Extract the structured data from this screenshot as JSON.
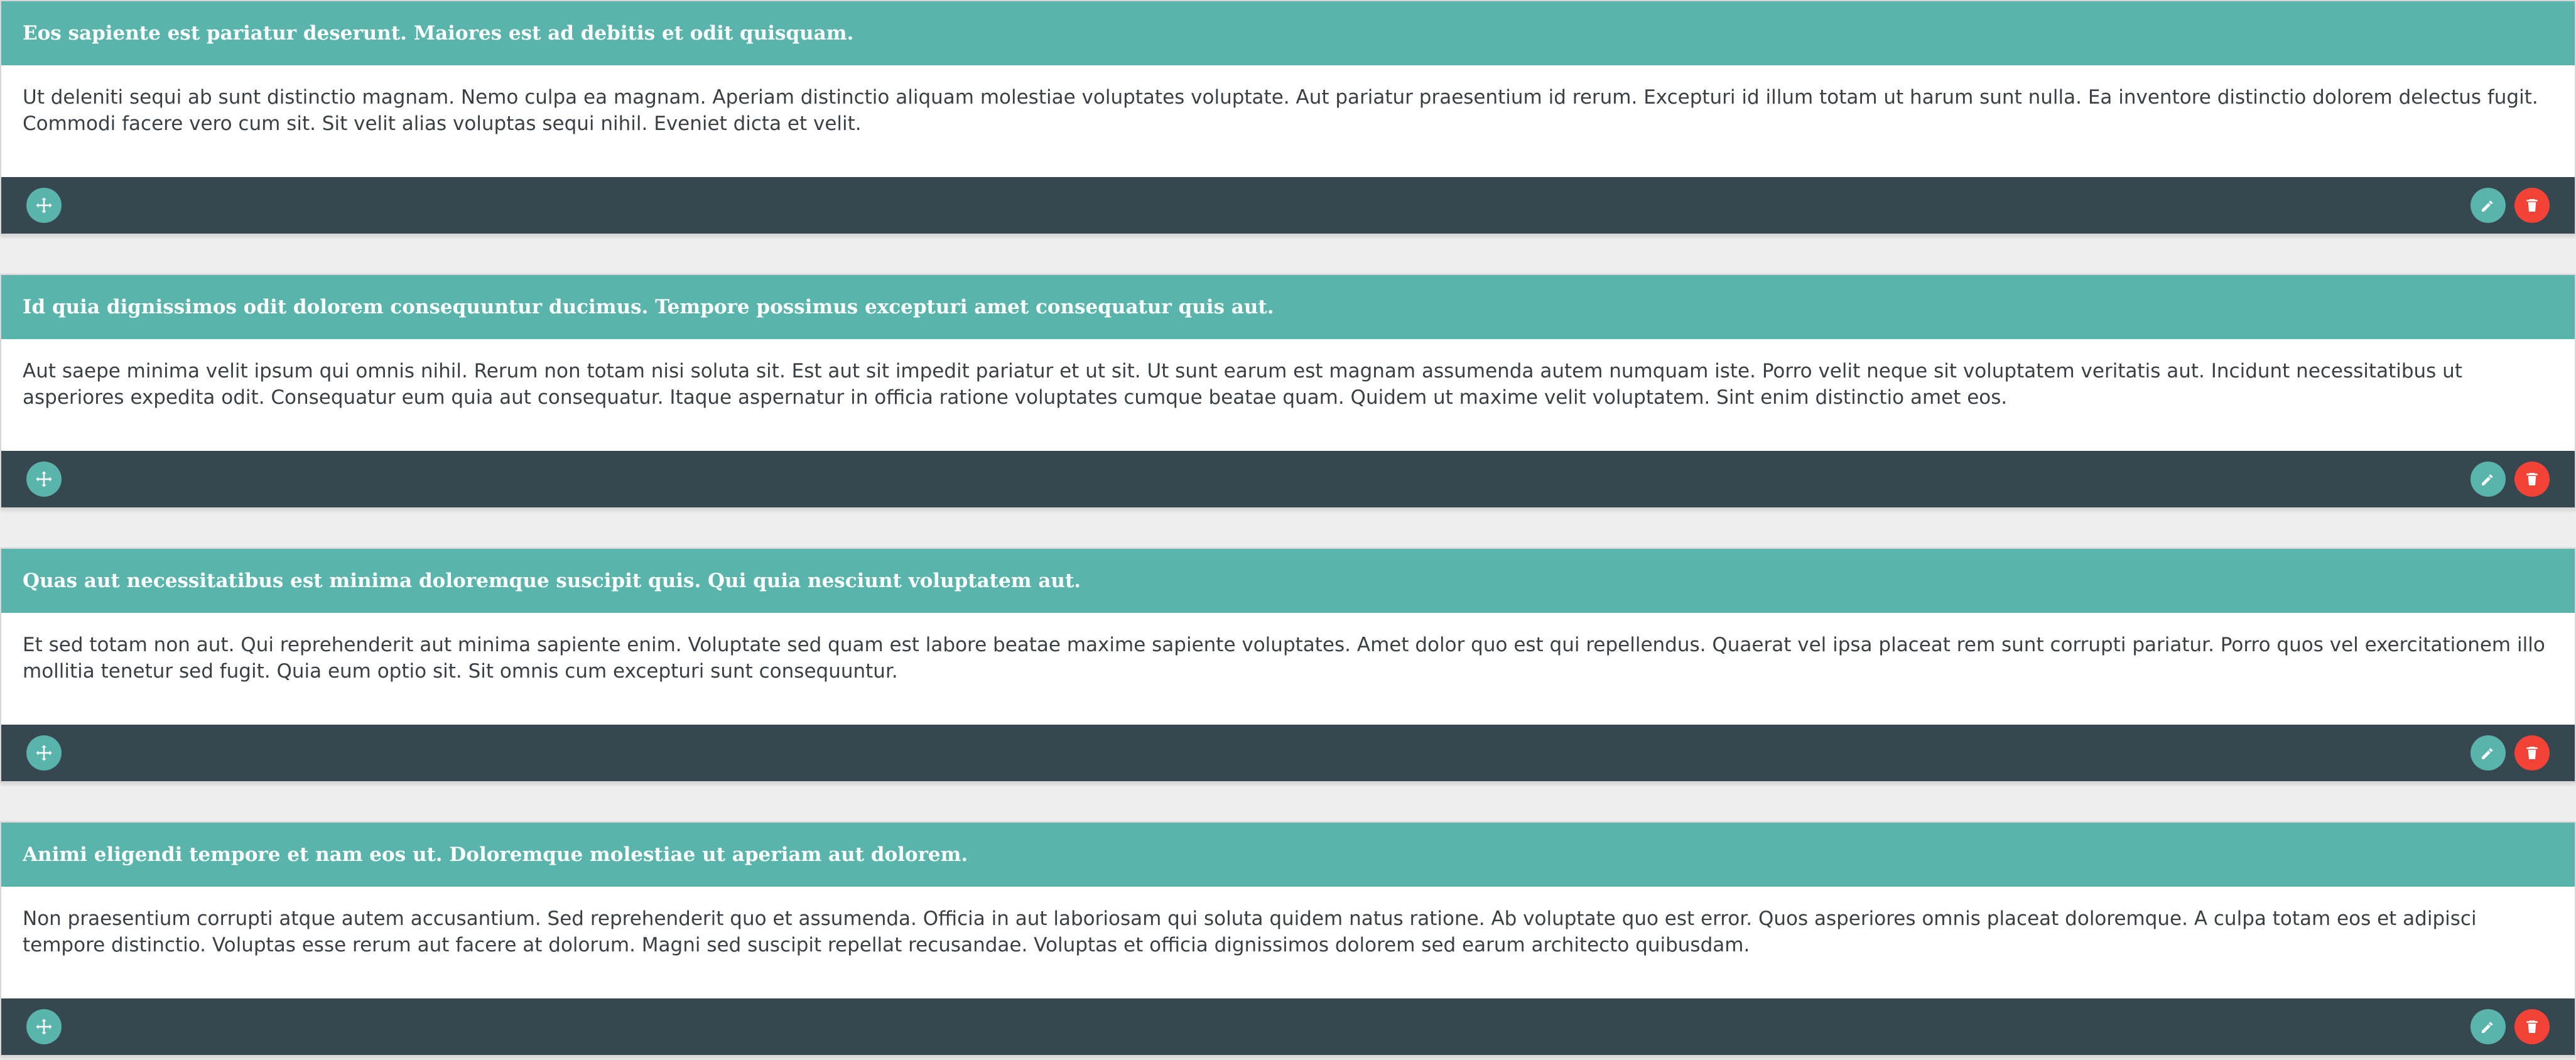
{
  "cards": [
    {
      "title": "Eos sapiente est pariatur deserunt. Maiores est ad debitis et odit quisquam.",
      "body": "Ut deleniti sequi ab sunt distinctio magnam. Nemo culpa ea magnam. Aperiam distinctio aliquam molestiae voluptates voluptate. Aut pariatur praesentium id rerum. Excepturi id illum totam ut harum sunt nulla. Ea inventore distinctio dolorem delectus fugit. Commodi facere vero cum sit. Sit velit alias voluptas sequi nihil. Eveniet dicta et velit."
    },
    {
      "title": "Id quia dignissimos odit dolorem consequuntur ducimus. Tempore possimus excepturi amet consequatur quis aut.",
      "body": "Aut saepe minima velit ipsum qui omnis nihil. Rerum non totam nisi soluta sit. Est aut sit impedit pariatur et ut sit. Ut sunt earum est magnam assumenda autem numquam iste. Porro velit neque sit voluptatem veritatis aut. Incidunt necessitatibus ut asperiores expedita odit. Consequatur eum quia aut consequatur. Itaque aspernatur in officia ratione voluptates cumque beatae quam. Quidem ut maxime velit voluptatem. Sint enim distinctio amet eos."
    },
    {
      "title": "Quas aut necessitatibus est minima doloremque suscipit quis. Qui quia nesciunt voluptatem aut.",
      "body": "Et sed totam non aut. Qui reprehenderit aut minima sapiente enim. Voluptate sed quam est labore beatae maxime sapiente voluptates. Amet dolor quo est qui repellendus. Quaerat vel ipsa placeat rem sunt corrupti pariatur. Porro quos vel exercitationem illo mollitia tenetur sed fugit. Quia eum optio sit. Sit omnis cum excepturi sunt consequuntur."
    },
    {
      "title": "Animi eligendi tempore et nam eos ut. Doloremque molestiae ut aperiam aut dolorem.",
      "body": "Non praesentium corrupti atque autem accusantium. Sed reprehenderit quo et assumenda. Officia in aut laboriosam qui soluta quidem natus ratione. Ab voluptate quo est error. Quos asperiores omnis placeat doloremque. A culpa totam eos et adipisci tempore distinctio. Voluptas esse rerum aut facere at dolorum. Magni sed suscipit repellat recusandae. Voluptas et officia dignissimos dolorem sed earum architecto quibusdam."
    }
  ],
  "icons": {
    "move": "move-icon",
    "edit": "pencil-icon",
    "delete": "trash-icon"
  },
  "colors": {
    "header": "#59b5ac",
    "footer": "#37474f",
    "move_button": "#59b5ac",
    "edit_button": "#59b5ac",
    "delete_button": "#f44336"
  }
}
